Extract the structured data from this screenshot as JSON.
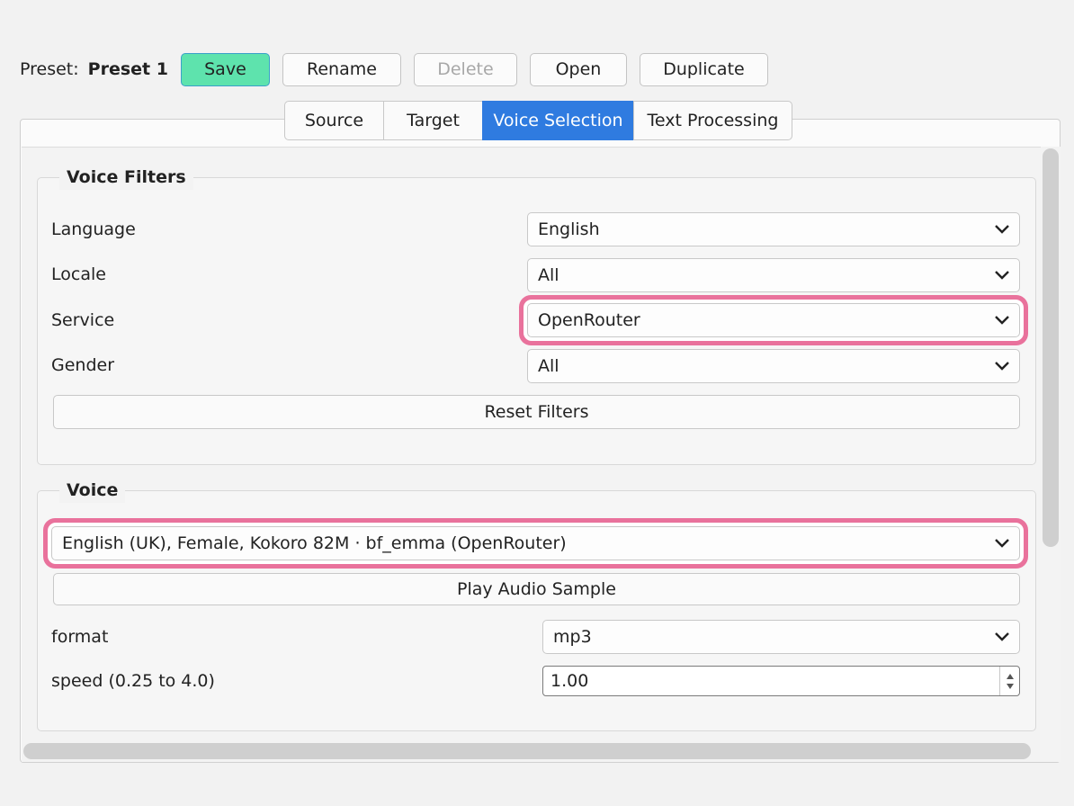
{
  "preset": {
    "label": "Preset:",
    "name": "Preset 1",
    "buttons": {
      "save": "Save",
      "rename": "Rename",
      "delete": "Delete",
      "open": "Open",
      "duplicate": "Duplicate"
    }
  },
  "tabs": [
    {
      "label": "Source"
    },
    {
      "label": "Target"
    },
    {
      "label": "Voice Selection",
      "active": true
    },
    {
      "label": "Text Processing"
    }
  ],
  "voice_filters": {
    "title": "Voice Filters",
    "language": {
      "label": "Language",
      "value": "English"
    },
    "locale": {
      "label": "Locale",
      "value": "All"
    },
    "service": {
      "label": "Service",
      "value": "OpenRouter"
    },
    "gender": {
      "label": "Gender",
      "value": "All"
    },
    "reset_label": "Reset Filters"
  },
  "voice": {
    "title": "Voice",
    "selected": "English (UK), Female, Kokoro 82M · bf_emma (OpenRouter)",
    "play_label": "Play Audio Sample",
    "format": {
      "label": "format",
      "value": "mp3"
    },
    "speed": {
      "label": "speed (0.25 to 4.0)",
      "value": "1.00"
    }
  },
  "colors": {
    "save_accent": "#5ee3ad",
    "active_tab": "#2f7be0",
    "highlight": "#e65a8c"
  }
}
